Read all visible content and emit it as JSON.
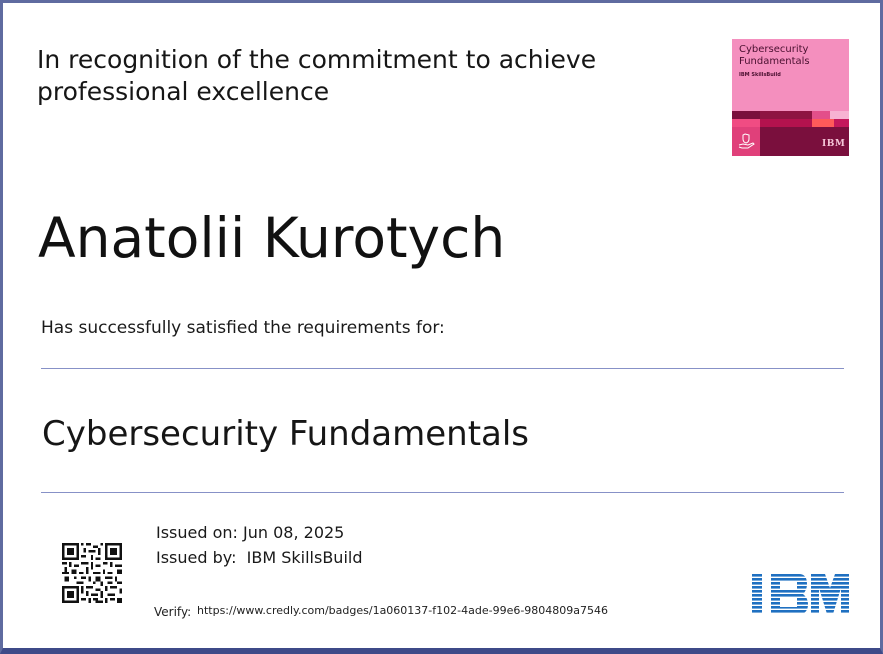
{
  "certificate": {
    "recognition_line1": "In recognition of the commitment to achieve",
    "recognition_line2": "professional excellence",
    "recipient_name": "Anatolii Kurotych",
    "requirement_text": "Has successfully satisfied the requirements for:",
    "course_title": "Cybersecurity Fundamentals",
    "issued_on": "Issued on: Jun 08, 2025",
    "issued_by_label": "Issued by:",
    "issued_by_value": "IBM SkillsBuild",
    "verify_label": "Verify:",
    "verify_url": "https://www.credly.com/badges/1a060137-f102-4ade-99e6-9804809a7546"
  },
  "badge": {
    "title_line1": "Cybersecurity",
    "title_line2": "Fundamentals",
    "provider": "IBM SkillsBuild",
    "logo_text": "IBM",
    "colors": {
      "pink": "#f48fbe",
      "maroon": "#7a0f3d",
      "crimson": "#b3124e"
    }
  },
  "icons": {
    "qr": "qr-code-icon",
    "ibm_logo": "ibm-logo",
    "badge_icon": "hand-shield-icon"
  },
  "colors": {
    "border": "#5f6ba0",
    "rule": "#8791c7",
    "ibm_blue": "#1f70c1"
  }
}
